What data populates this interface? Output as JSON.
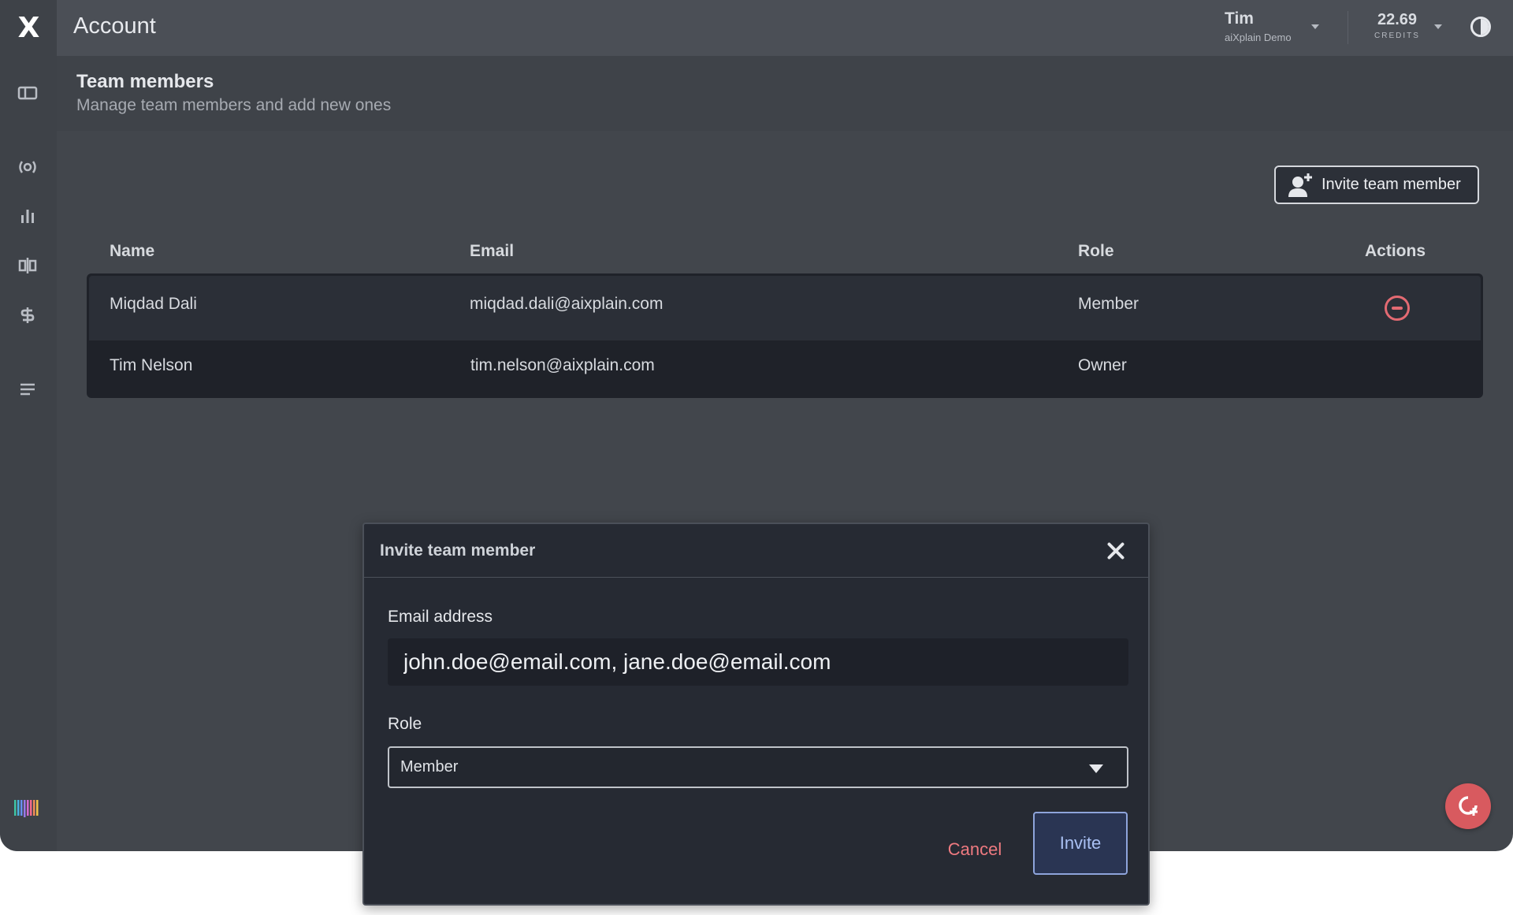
{
  "app": {
    "logo_text": "X",
    "title": "Account"
  },
  "user": {
    "name": "Tim",
    "org": "aiXplain Demo"
  },
  "credits": {
    "value": "22.69",
    "label": "CREDITS"
  },
  "sidebar": {
    "icons": [
      "dashboard-icon",
      "broadcast-icon",
      "bar-chart-icon",
      "split-icon",
      "billing-icon",
      "list-icon",
      "brand-bars-icon"
    ]
  },
  "page": {
    "title": "Team members",
    "subtitle": "Manage team members and add new ones"
  },
  "toolbar": {
    "invite_label": "Invite team member"
  },
  "table": {
    "columns": [
      "Name",
      "Email",
      "Role",
      "Actions"
    ],
    "rows": [
      {
        "name": "Miqdad Dali",
        "email": "miqdad.dali@aixplain.com",
        "role": "Member",
        "action": "remove-icon"
      },
      {
        "name": "Tim Nelson",
        "email": "tim.nelson@aixplain.com",
        "role": "Owner",
        "action": ""
      }
    ]
  },
  "modal": {
    "title": "Invite team member",
    "email_label": "Email address",
    "email_value": "john.doe@email.com, jane.doe@email.com",
    "role_label": "Role",
    "role_value": "Member",
    "cancel_label": "Cancel",
    "invite_label": "Invite"
  },
  "colors": {
    "danger": "#e36a72",
    "accent": "#8ea4db",
    "fab": "#d85a5f"
  }
}
